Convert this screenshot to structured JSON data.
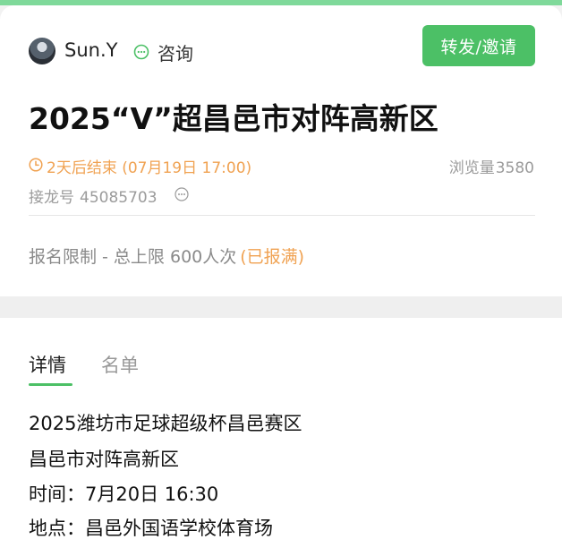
{
  "colors": {
    "accent_green": "#4cc066",
    "warning_orange": "#f0a252",
    "muted_gray": "#9b9b9b"
  },
  "header": {
    "user_name": "Sun.Y",
    "consult_label": "咨询",
    "share_button_label": "转发/邀请",
    "icons": [
      "avatar",
      "chat-icon"
    ]
  },
  "event": {
    "title": "2025“V”超昌邑市对阵高新区",
    "deadline": "2天后结束 (07月19日 17:00)",
    "views_label": "浏览量",
    "views_count": "3580",
    "relay_label": "接龙号",
    "relay_number": "45085703",
    "limit_text": "报名限制 - 总上限 600人次",
    "limit_status": "(已报满)",
    "icons": [
      "clock-icon",
      "more-icon"
    ]
  },
  "tabs": [
    {
      "label": "详情",
      "active": true
    },
    {
      "label": "名单",
      "active": false
    }
  ],
  "details": [
    "2025潍坊市足球超级杯昌邑赛区",
    "昌邑市对阵高新区",
    "时间：7月20日 16:30",
    "地点：昌邑外国语学校体育场"
  ]
}
